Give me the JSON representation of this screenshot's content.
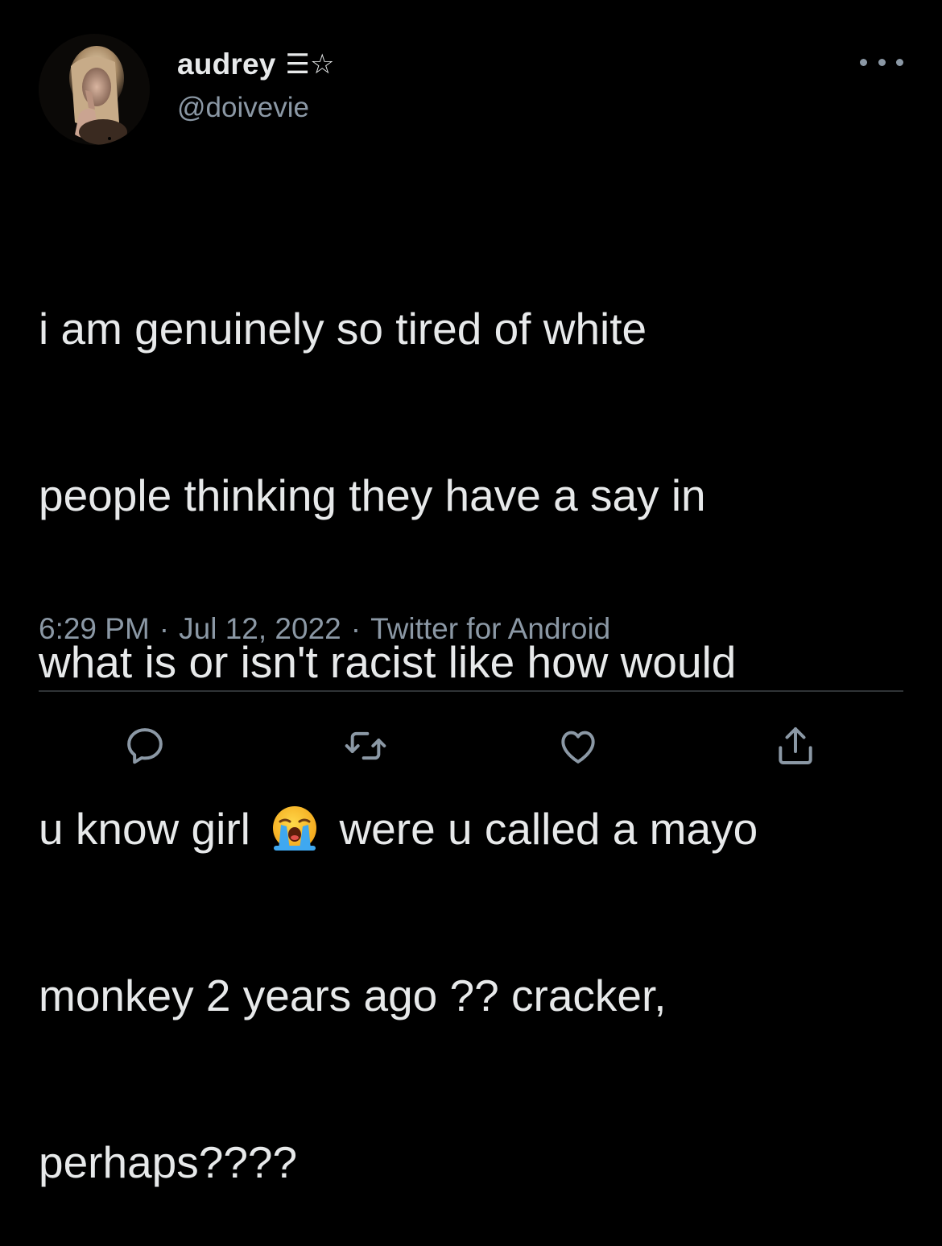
{
  "author": {
    "display_name": "audrey",
    "name_decoration": "☰☆",
    "handle": "@doivevie"
  },
  "tweet": {
    "lines": [
      "i am genuinely so tired of white",
      "people thinking they have a say in",
      "what is or isn't racist like how would",
      "u know girl",
      "were u called a mayo",
      "monkey 2 years ago ?? cracker,",
      "perhaps????"
    ],
    "emoji": "loudly-crying-face"
  },
  "meta": {
    "time": "6:29 PM",
    "date": "Jul 12, 2022",
    "source": "Twitter for Android",
    "separator": "·"
  },
  "actions": {
    "icons": [
      "reply-icon",
      "retweet-icon",
      "like-icon",
      "share-icon"
    ]
  },
  "colors": {
    "background": "#000000",
    "text": "#e7e9ea",
    "secondary_text": "#8b98a5",
    "divider": "#2f3336"
  }
}
